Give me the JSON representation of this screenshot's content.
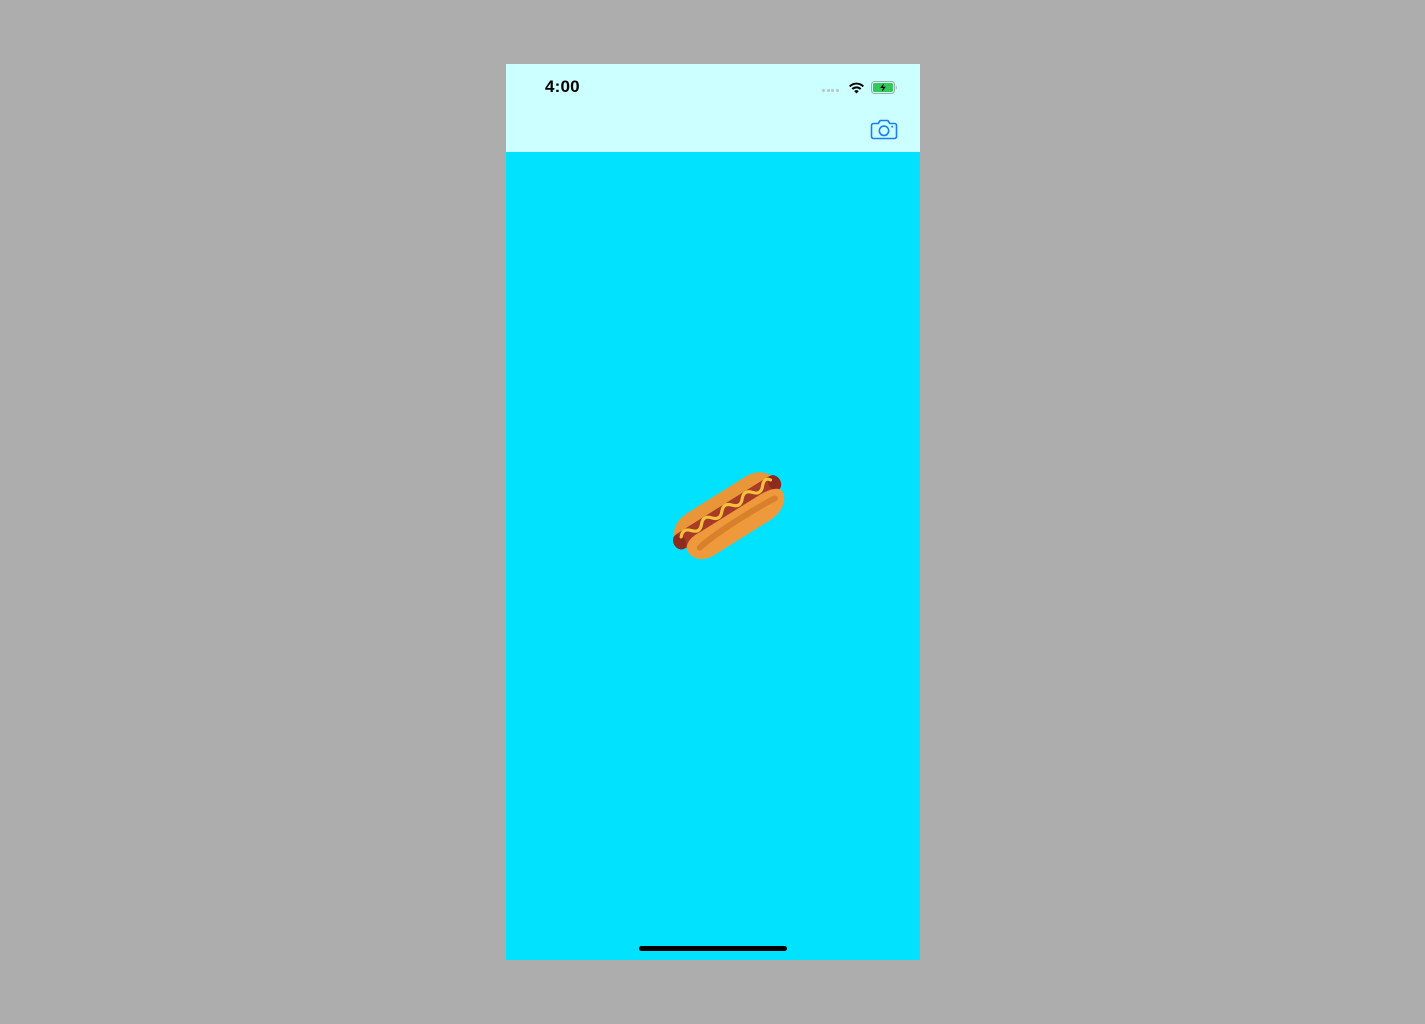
{
  "status_bar": {
    "time": "4:00",
    "signal_icon": "cellular-signal-dots-icon",
    "wifi_icon": "wifi-icon",
    "battery_icon": "battery-charging-icon"
  },
  "nav_bar": {
    "camera_icon": "camera-icon"
  },
  "content": {
    "image_icon": "hotdog-image"
  },
  "colors": {
    "background": "#00e2ff",
    "nav_background": "#ccffff",
    "accent": "#1b7cf5",
    "outer": "#adadad"
  }
}
